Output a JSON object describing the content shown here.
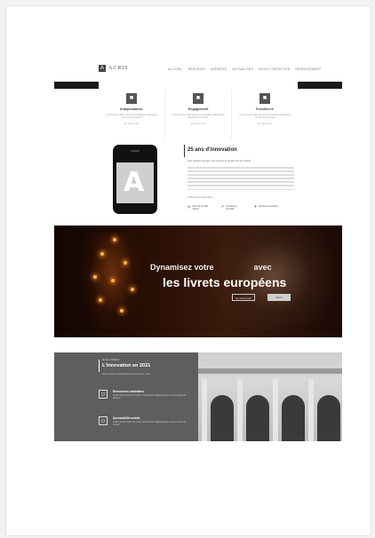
{
  "header": {
    "logo_mark": "A",
    "logo_text": "ACRIS",
    "nav": [
      "Accueil",
      "Services",
      "Agences",
      "Actualités",
      "Nous contacter",
      "Recrutement"
    ]
  },
  "features": [
    {
      "icon": "■",
      "title": "Indépendance",
      "text": "Lorem ipsum dolor sit amet consectetur adipiscing elit sed do eiusmod",
      "link": "En savoir plus"
    },
    {
      "icon": "■",
      "title": "Engagement",
      "text": "Lorem ipsum dolor sit amet consectetur adipiscing elit sed do eiusmod",
      "link": "En savoir plus"
    },
    {
      "icon": "■",
      "title": "Excellence",
      "text": "Lorem ipsum dolor sit amet consectetur adipiscing elit sed do eiusmod",
      "link": "En savoir plus"
    }
  ],
  "innovation": {
    "phone_mark": "A",
    "title": "25 ans d'innovation",
    "subtitle": "Une banque tournée vers l'avenir et proche de ses clients",
    "note": "Télécharger l'application",
    "stats": [
      {
        "icon": "◎",
        "text": "Plus de 10 000 clients"
      },
      {
        "icon": "↗",
        "text": "Croissance annuelle"
      },
      {
        "icon": "✦",
        "text": "Services innovants"
      }
    ]
  },
  "hero": {
    "line1_prefix": "Dynamisez votre",
    "line1_suffix": "avec",
    "line2": "les livrets européens",
    "btn_ghost": "En savoir plus",
    "btn_solid": "Ouvrir"
  },
  "bottom": {
    "kicker": "Notre ambition",
    "title": "L'innovation en 2021",
    "subtitle": "Des solutions bancaires pensées pour vous",
    "items": [
      {
        "icon": "◻",
        "title": "Ressources nationales",
        "text": "Lorem ipsum dolor sit amet, consectetur adipiscing elit, sed do eiusmod tempor"
      },
      {
        "icon": "◻",
        "title": "Accessibilité mobile",
        "text": "Lorem ipsum dolor sit amet, consectetur adipiscing elit, sed do eiusmod tempor"
      }
    ]
  },
  "colors": {
    "accent_dark": "#1a1a1a",
    "panel_gray": "#5e5e5e",
    "hero_warm": "#2a0f05"
  }
}
